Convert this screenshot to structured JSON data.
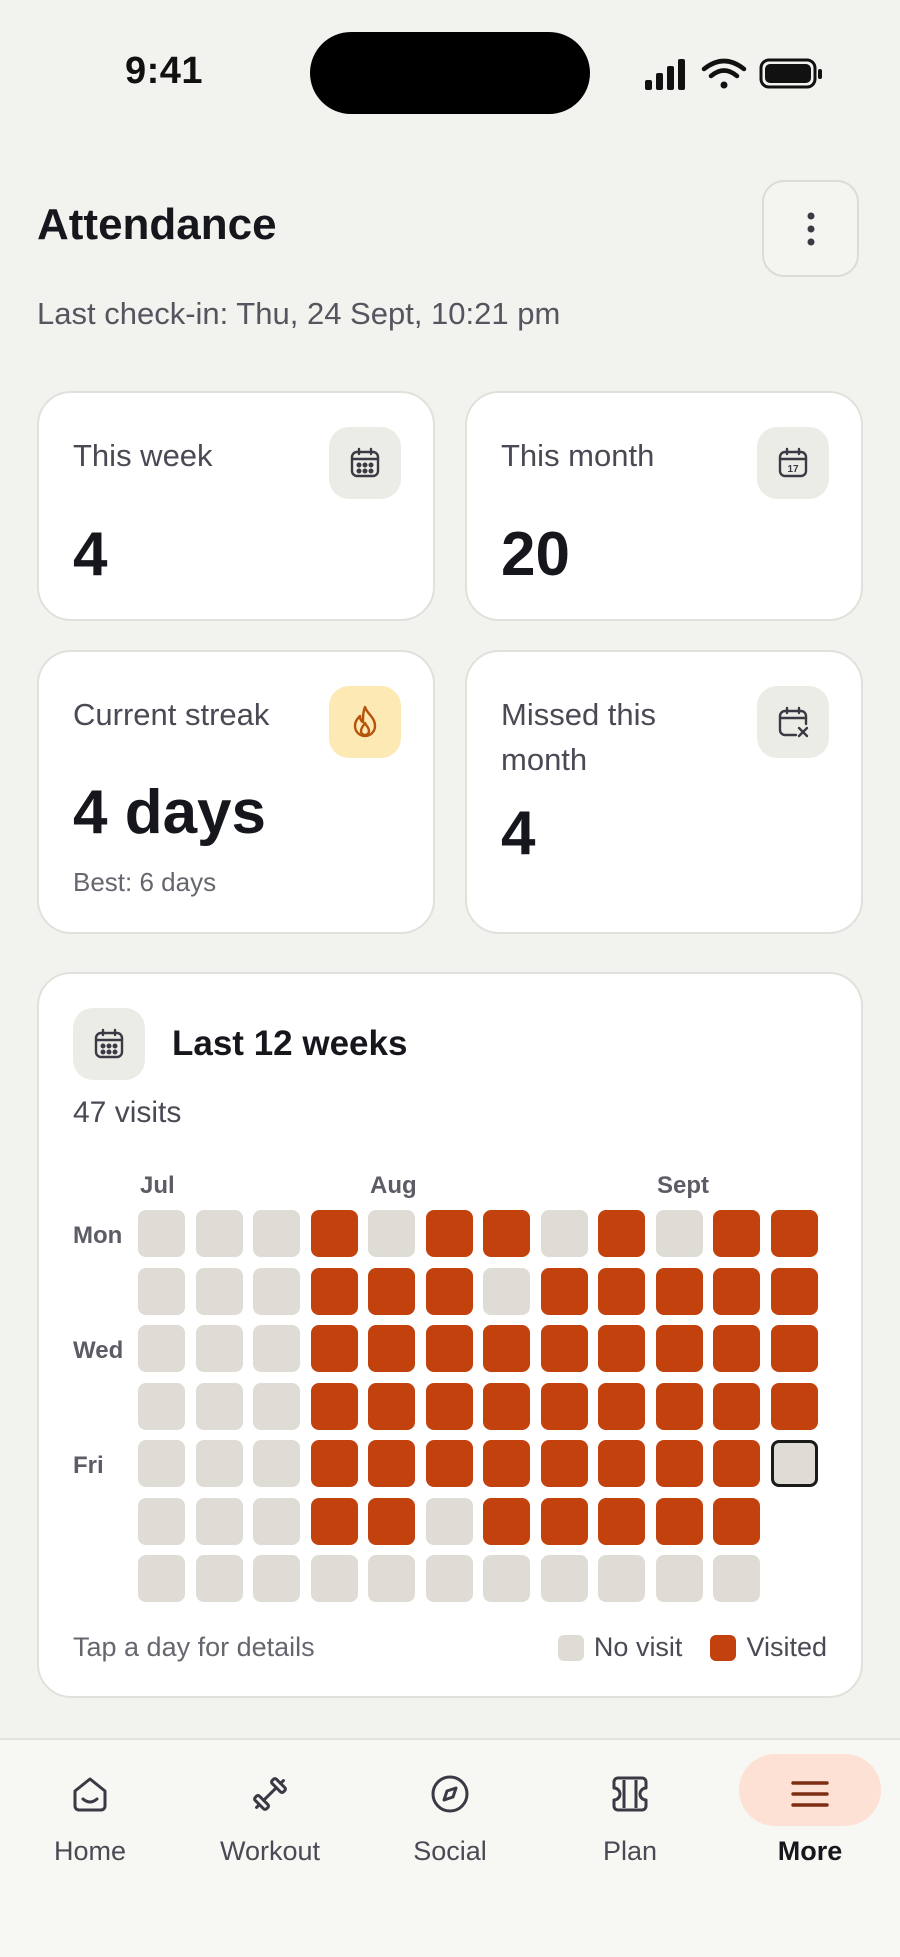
{
  "status_bar": {
    "time": "9:41"
  },
  "header": {
    "title": "Attendance",
    "last_checkin": "Last check-in: Thu, 24 Sept, 10:21 pm"
  },
  "stats": {
    "this_week": {
      "label": "This week",
      "value": "4",
      "icon": "calendar-icon"
    },
    "this_month": {
      "label": "This month",
      "value": "20",
      "icon": "calendar-date-icon",
      "icon_text": "17"
    },
    "streak": {
      "label": "Current streak",
      "value": "4 days",
      "sub": "Best: 6 days",
      "icon": "flame-icon"
    },
    "missed": {
      "label": "Missed this month",
      "value": "4",
      "icon": "calendar-x-icon"
    }
  },
  "heatmap": {
    "title": "Last 12 weeks",
    "visits": "47 visits",
    "months": [
      "Jul",
      "Aug",
      "Sept"
    ],
    "days": [
      "Mon",
      "Wed",
      "Fri"
    ],
    "hint": "Tap a day for details",
    "legend_no_visit": "No visit",
    "legend_visited": "Visited",
    "colors": {
      "visited": "#c2410c",
      "no_visit": "#dedcd4"
    },
    "weeks": [
      [
        0,
        0,
        0,
        0,
        0,
        0,
        0
      ],
      [
        0,
        0,
        0,
        0,
        0,
        0,
        0
      ],
      [
        0,
        0,
        0,
        0,
        0,
        0,
        0
      ],
      [
        1,
        1,
        1,
        1,
        1,
        1,
        0
      ],
      [
        0,
        1,
        1,
        1,
        1,
        1,
        0
      ],
      [
        1,
        1,
        1,
        1,
        1,
        0,
        0
      ],
      [
        1,
        0,
        1,
        1,
        1,
        1,
        0
      ],
      [
        0,
        1,
        1,
        1,
        1,
        1,
        0
      ],
      [
        1,
        1,
        1,
        1,
        1,
        1,
        0
      ],
      [
        0,
        1,
        1,
        1,
        1,
        1,
        0
      ],
      [
        1,
        1,
        1,
        1,
        1,
        1,
        0
      ],
      [
        1,
        1,
        1,
        1,
        2,
        -1,
        -1
      ]
    ]
  },
  "tabs": [
    {
      "label": "Home",
      "icon": "home-icon"
    },
    {
      "label": "Workout",
      "icon": "dumbbell-icon"
    },
    {
      "label": "Social",
      "icon": "compass-icon"
    },
    {
      "label": "Plan",
      "icon": "ticket-icon"
    },
    {
      "label": "More",
      "icon": "menu-icon",
      "active": true
    }
  ]
}
